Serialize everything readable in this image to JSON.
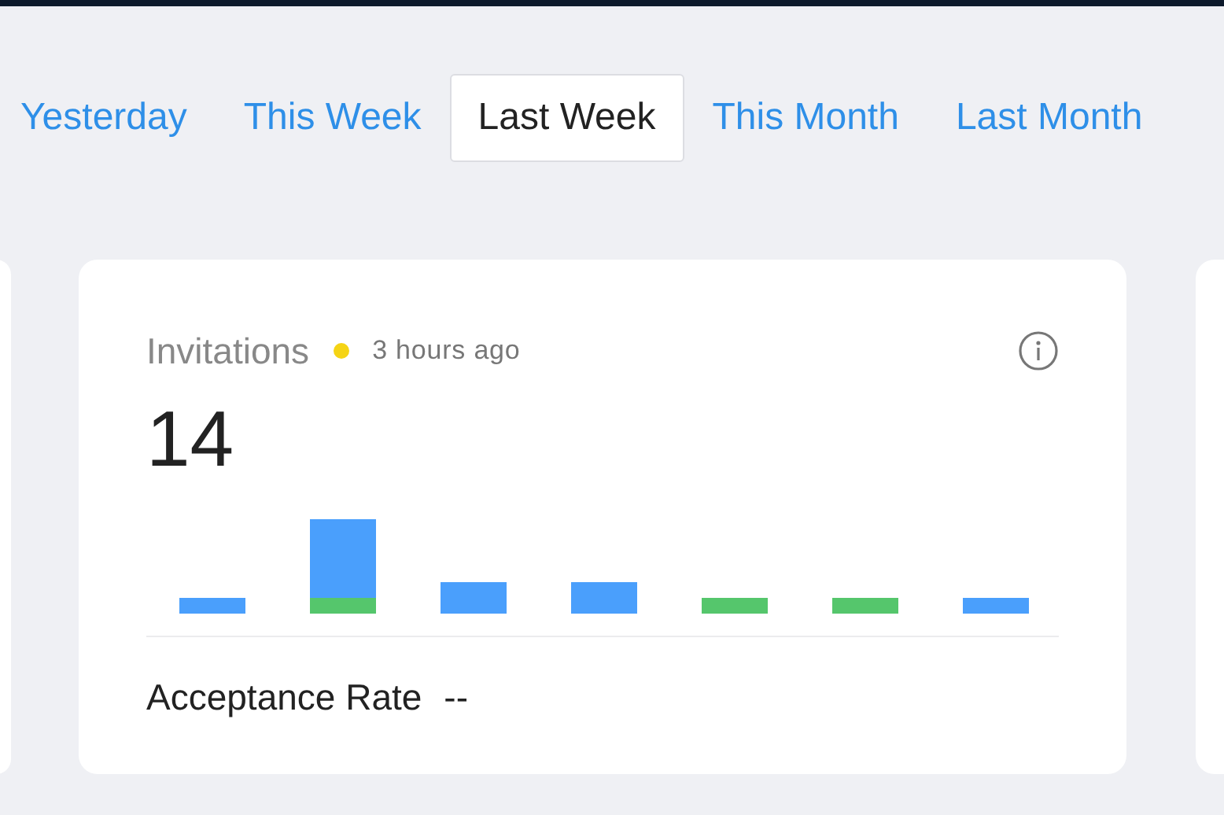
{
  "tabs": [
    {
      "label": "Yesterday",
      "selected": false
    },
    {
      "label": "This Week",
      "selected": false
    },
    {
      "label": "Last Week",
      "selected": true
    },
    {
      "label": "This Month",
      "selected": false
    },
    {
      "label": "Last Month",
      "selected": false
    }
  ],
  "card": {
    "title": "Invitations",
    "status": {
      "text": "3 hours ago",
      "color": "#f5d415"
    },
    "value": "14",
    "footer_label": "Acceptance Rate",
    "footer_value": "--"
  }
}
